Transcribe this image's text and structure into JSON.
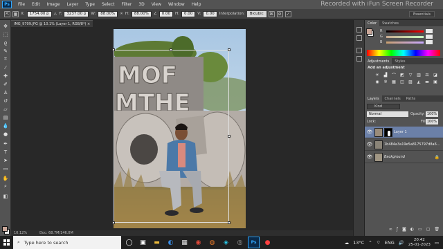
{
  "menubar": {
    "logo": "Ps",
    "items": [
      "File",
      "Edit",
      "Image",
      "Layer",
      "Type",
      "Select",
      "Filter",
      "3D",
      "View",
      "Window",
      "Help"
    ]
  },
  "watermark": "Recorded with iFun Screen Recorder",
  "options": {
    "x_label": "X:",
    "x_value": "1754.00 p",
    "y_label": "Y:",
    "y_value": "3237.00 p",
    "w_label": "W:",
    "w_value": "88.00%",
    "h_label": "H:",
    "h_value": "88.00%",
    "angle_value": "0.00",
    "h_skew_label": "H:",
    "h_skew_value": "0.00",
    "v_skew_label": "V:",
    "v_skew_value": "0.00",
    "interp_label": "Interpolation:",
    "interp_value": "Bicubic",
    "workspace": "Essentials"
  },
  "document": {
    "tab_title": "IMG_9709.JPG @ 10.1% (Layer 1, RGB/8*) ×",
    "zoom": "10.12%",
    "doc_size": "Doc: 68.7M/146.0M"
  },
  "color_panel": {
    "tabs": [
      "Color",
      "Swatches"
    ],
    "r_label": "R",
    "g_label": "G",
    "b_label": "B",
    "colors": {
      "fg": "#caa799",
      "bg": "#f0f0f0"
    }
  },
  "adjustments_panel": {
    "tabs": [
      "Adjustments",
      "Styles"
    ],
    "heading": "Add an adjustment"
  },
  "layers_panel": {
    "tabs": [
      "Layers",
      "Channels",
      "Paths"
    ],
    "kind_label": "Kind",
    "blend_mode": "Normal",
    "opacity_label": "Opacity:",
    "opacity_value": "100%",
    "lock_label": "Lock:",
    "fill_label": "Fill:",
    "fill_value": "100%",
    "layers": [
      {
        "name": "Layer 1",
        "active": true
      },
      {
        "name": "1b484a3a19e5a8175797d8a6...",
        "active": false
      },
      {
        "name": "Background",
        "active": false
      }
    ]
  },
  "taskbar": {
    "search_placeholder": "Type here to search",
    "weather": "13°C",
    "language": "ENG",
    "time": "20:42",
    "date": "25-01-2023"
  }
}
